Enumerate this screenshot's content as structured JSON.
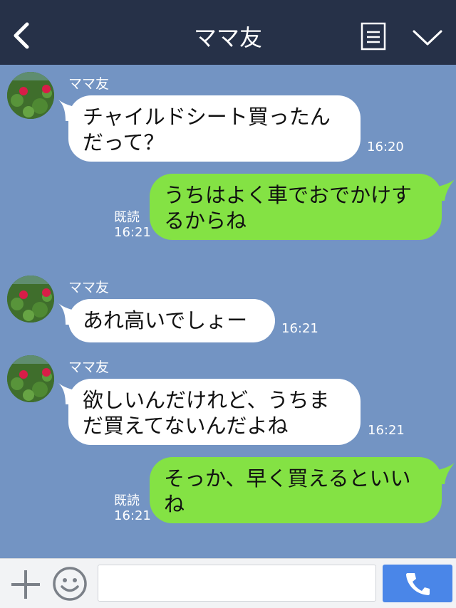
{
  "header": {
    "title": "ママ友",
    "back_icon": "chevron-left-icon",
    "menu_icon": "notes-icon",
    "collapse_icon": "chevron-down-icon"
  },
  "messages": [
    {
      "direction": "incoming",
      "sender": "ママ友",
      "lines": [
        "チャイルドシート買ったん",
        "だって？"
      ],
      "time": "16:20"
    },
    {
      "direction": "outgoing",
      "lines": [
        "うちはよく車でおでかけす",
        "るからね"
      ],
      "read": "既読",
      "time": "16:21"
    },
    {
      "direction": "incoming",
      "sender": "ママ友",
      "lines": [
        "あれ高いでしょー"
      ],
      "time": "16:21"
    },
    {
      "direction": "incoming",
      "sender": "ママ友",
      "lines": [
        "欲しいんだけれど、うちま",
        "だ買えてないんだよね"
      ],
      "time": "16:21"
    },
    {
      "direction": "outgoing",
      "lines": [
        "そっか、早く買えるといい",
        "ね"
      ],
      "read": "既読",
      "time": "16:21"
    }
  ],
  "footer": {
    "plus_icon": "plus-icon",
    "emoji_icon": "smiley-icon",
    "input_value": "",
    "call_icon": "phone-icon"
  },
  "colors": {
    "header_bg": "#263148",
    "chat_bg": "#7394c3",
    "incoming_bubble": "#ffffff",
    "outgoing_bubble": "#84e244",
    "call_button": "#4a86e8"
  }
}
